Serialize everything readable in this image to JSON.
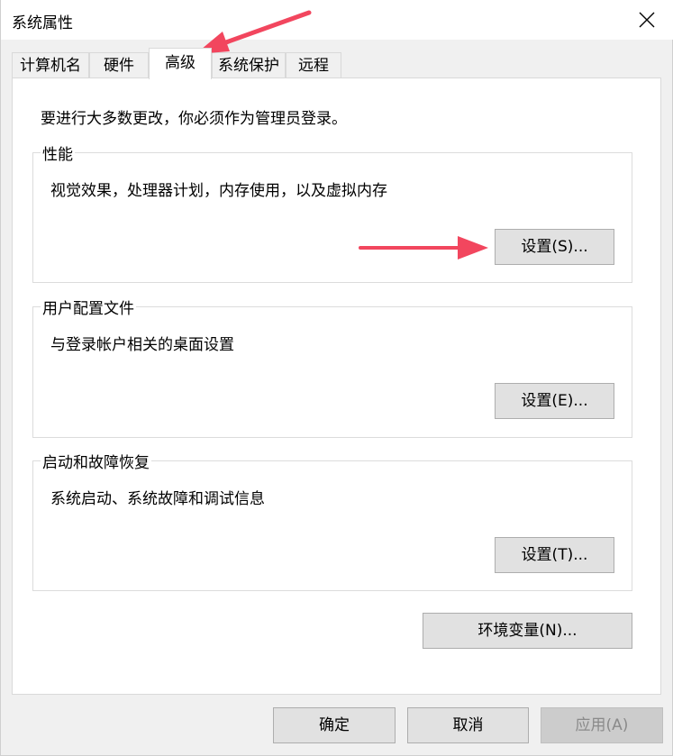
{
  "window": {
    "title": "系统属性"
  },
  "tabs": [
    {
      "label": "计算机名"
    },
    {
      "label": "硬件"
    },
    {
      "label": "高级"
    },
    {
      "label": "系统保护"
    },
    {
      "label": "远程"
    }
  ],
  "active_tab": "高级",
  "advanced": {
    "admin_note": "要进行大多数更改，你必须作为管理员登录。",
    "performance": {
      "title": "性能",
      "description": "视觉效果，处理器计划，内存使用，以及虚拟内存",
      "button": "设置(S)..."
    },
    "user_profiles": {
      "title": "用户配置文件",
      "description": "与登录帐户相关的桌面设置",
      "button": "设置(E)..."
    },
    "startup_recovery": {
      "title": "启动和故障恢复",
      "description": "系统启动、系统故障和调试信息",
      "button": "设置(T)..."
    },
    "env_vars_button": "环境变量(N)..."
  },
  "footer": {
    "ok": "确定",
    "cancel": "取消",
    "apply": "应用(A)"
  },
  "colors": {
    "annotation_arrow": "#f2465e"
  },
  "icons": {
    "close": "close-icon"
  }
}
